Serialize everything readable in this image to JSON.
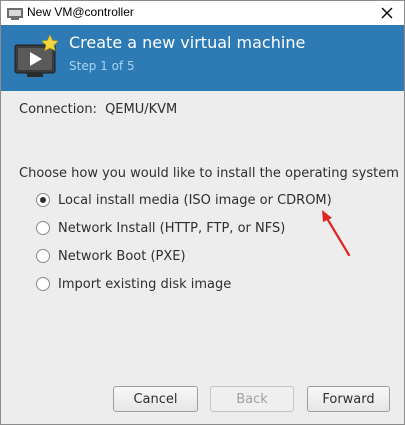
{
  "window": {
    "title": "New VM@controller",
    "close_icon": "close-icon"
  },
  "banner": {
    "title": "Create a new virtual machine",
    "subtitle": "Step 1 of 5",
    "icon": "virtual-machine-icon"
  },
  "connection": {
    "label": "Connection:",
    "value": "QEMU/KVM"
  },
  "install": {
    "prompt": "Choose how you would like to install the operating system",
    "options": [
      {
        "label": "Local install media (ISO image or CDROM)",
        "selected": true
      },
      {
        "label": "Network Install (HTTP, FTP, or NFS)",
        "selected": false
      },
      {
        "label": "Network Boot (PXE)",
        "selected": false
      },
      {
        "label": "Import existing disk image",
        "selected": false
      }
    ]
  },
  "buttons": {
    "cancel": "Cancel",
    "back": "Back",
    "forward": "Forward"
  },
  "annotation": {
    "arrow_color": "#e02424"
  },
  "colors": {
    "banner": "#2d7ab4",
    "banner_subtitle": "#a8d4f2"
  }
}
